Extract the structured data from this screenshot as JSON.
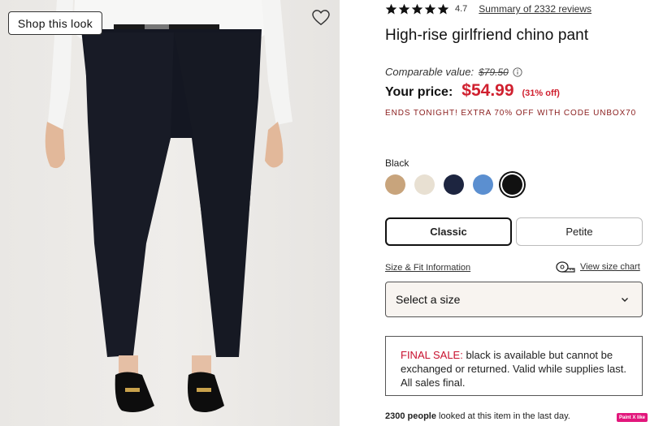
{
  "image": {
    "shop_look_label": "Shop this look"
  },
  "rating": {
    "stars": 5,
    "value": "4.7",
    "summary_link": "Summary of 2332 reviews"
  },
  "product": {
    "title": "High-rise girlfriend chino pant"
  },
  "pricing": {
    "comparable_label": "Comparable value:",
    "comparable_value": "$79.50",
    "your_price_label": "Your price:",
    "price": "$54.99",
    "discount": "(31% off)",
    "promo": "ENDS TONIGHT! EXTRA 70% OFF WITH CODE UNBOX70",
    "price_color": "#d0202f"
  },
  "color": {
    "selected_label": "Black",
    "swatches": [
      {
        "name": "tan",
        "hex": "#c8a47c",
        "selected": false
      },
      {
        "name": "ivory",
        "hex": "#e8e0d2",
        "selected": false
      },
      {
        "name": "navy",
        "hex": "#1d2540",
        "selected": false
      },
      {
        "name": "light-blue",
        "hex": "#5b8fd0",
        "selected": false
      },
      {
        "name": "black",
        "hex": "#111111",
        "selected": true
      }
    ]
  },
  "fit": {
    "options": [
      "Classic",
      "Petite"
    ],
    "selected": "Classic"
  },
  "size": {
    "info_link": "Size & Fit Information",
    "chart_link": "View size chart",
    "select_placeholder": "Select a size"
  },
  "final_sale": {
    "label": "FINAL SALE:",
    "text": " black is available but cannot be exchanged or returned. Valid while supplies last. All sales final."
  },
  "viewers": {
    "count": "2300 people",
    "text": " looked at this item in the last day."
  },
  "badge": {
    "label": "Paint X like"
  }
}
